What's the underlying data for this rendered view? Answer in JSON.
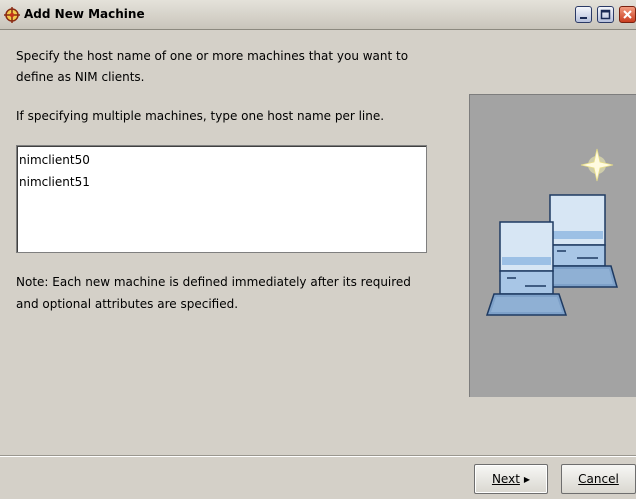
{
  "window": {
    "title": "Add New Machine",
    "app_icon": "crosshair-globe-icon",
    "controls": [
      "minimize-icon",
      "maximize-icon",
      "close-icon"
    ]
  },
  "body": {
    "intro_line1": "Specify the host name of one or more machines that you want to",
    "intro_line2": "define as NIM clients.",
    "instruction": "If specifying multiple machines, type one host name per line.",
    "host_names": "nimclient50\nnimclient51",
    "note_line1": "Note: Each new machine is defined immediately after its required",
    "note_line2": "and optional attributes are specified."
  },
  "illustration": {
    "icon": "networked-computers-icon",
    "background": "#a3a3a3"
  },
  "footer": {
    "next_label": "Next",
    "cancel_label": "Cancel"
  }
}
